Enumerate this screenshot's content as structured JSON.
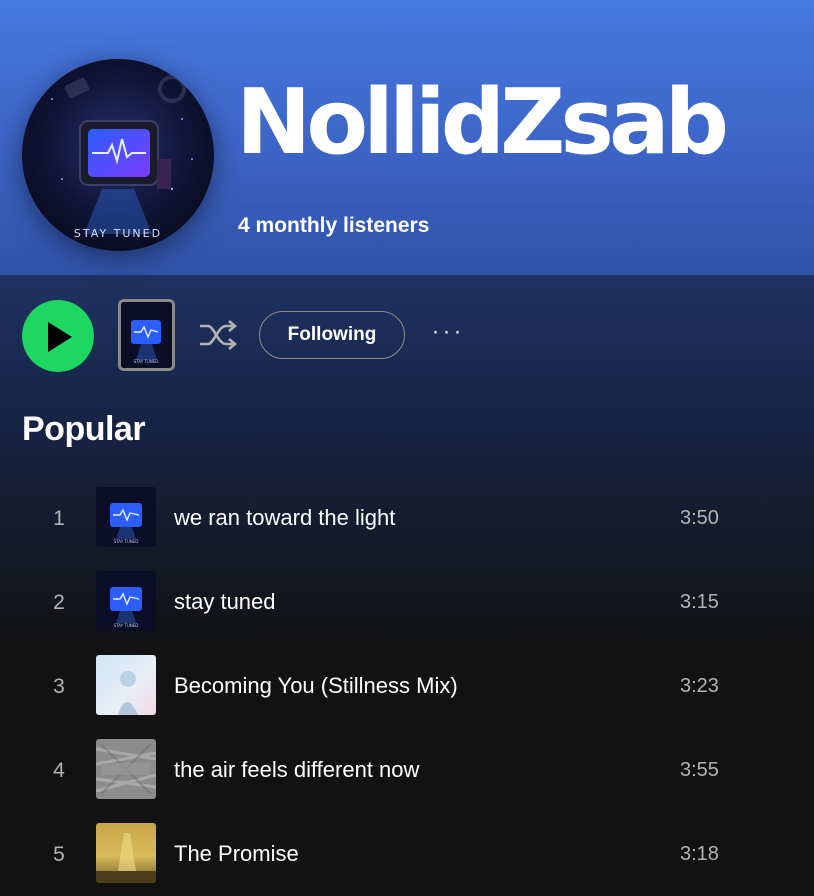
{
  "artist": {
    "name": "NollidZsab",
    "listeners": "4 monthly listeners",
    "cover_caption": "STAY TUNED"
  },
  "controls": {
    "follow_label": "Following",
    "more_label": "···"
  },
  "popular": {
    "title": "Popular",
    "tracks": [
      {
        "num": "1",
        "title": "we ran toward the light",
        "duration": "3:50",
        "art": "stay-tuned-cover"
      },
      {
        "num": "2",
        "title": "stay tuned",
        "duration": "3:15",
        "art": "stay-tuned-cover"
      },
      {
        "num": "3",
        "title": "Becoming You (Stillness Mix)",
        "duration": "3:23",
        "art": "becoming-you-cover"
      },
      {
        "num": "4",
        "title": "the air feels different now",
        "duration": "3:55",
        "art": "air-feels-different-cover"
      },
      {
        "num": "5",
        "title": "The Promise",
        "duration": "3:18",
        "art": "the-promise-cover"
      }
    ]
  },
  "colors": {
    "accent_green": "#1ed760",
    "hero_blue": "#4779e0",
    "background": "#121212",
    "secondary_text": "#b3b3b3"
  }
}
